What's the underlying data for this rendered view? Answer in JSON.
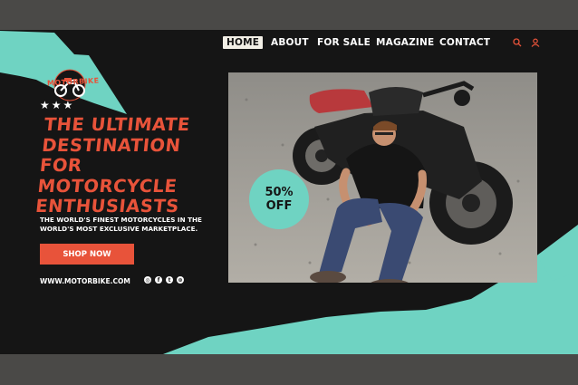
{
  "logo": {
    "text": "MOTORBIKE"
  },
  "nav": {
    "items": [
      {
        "label": "HOME",
        "active": true
      },
      {
        "label": "ABOUT",
        "active": false
      },
      {
        "label": "FOR SALE",
        "active": false
      },
      {
        "label": "MAGAZINE",
        "active": false
      },
      {
        "label": "CONTACT",
        "active": false
      }
    ],
    "icons": [
      "search-icon",
      "user-icon"
    ]
  },
  "hero": {
    "stars": "★★★",
    "headline_lines": [
      "THE ULTIMATE",
      "DESTINATION FOR",
      "MOTORCYCLE",
      "ENTHUSIASTS"
    ],
    "subtext_lines": [
      "THE WORLD'S FINEST MOTORCYCLES IN THE",
      "WORLD'S MOST EXCLUSIVE MARKETPLACE."
    ],
    "cta_label": "SHOP NOW",
    "url": "WWW.MOTORBIKE.COM",
    "social_icons": [
      "instagram-icon",
      "facebook-icon",
      "twitter-icon",
      "dribbble-icon"
    ]
  },
  "badge": {
    "line1": "50%",
    "line2": "OFF"
  },
  "colors": {
    "accent": "#e8533a",
    "teal": "#6fd3c2",
    "background": "#151515",
    "outer": "#4a4947"
  }
}
